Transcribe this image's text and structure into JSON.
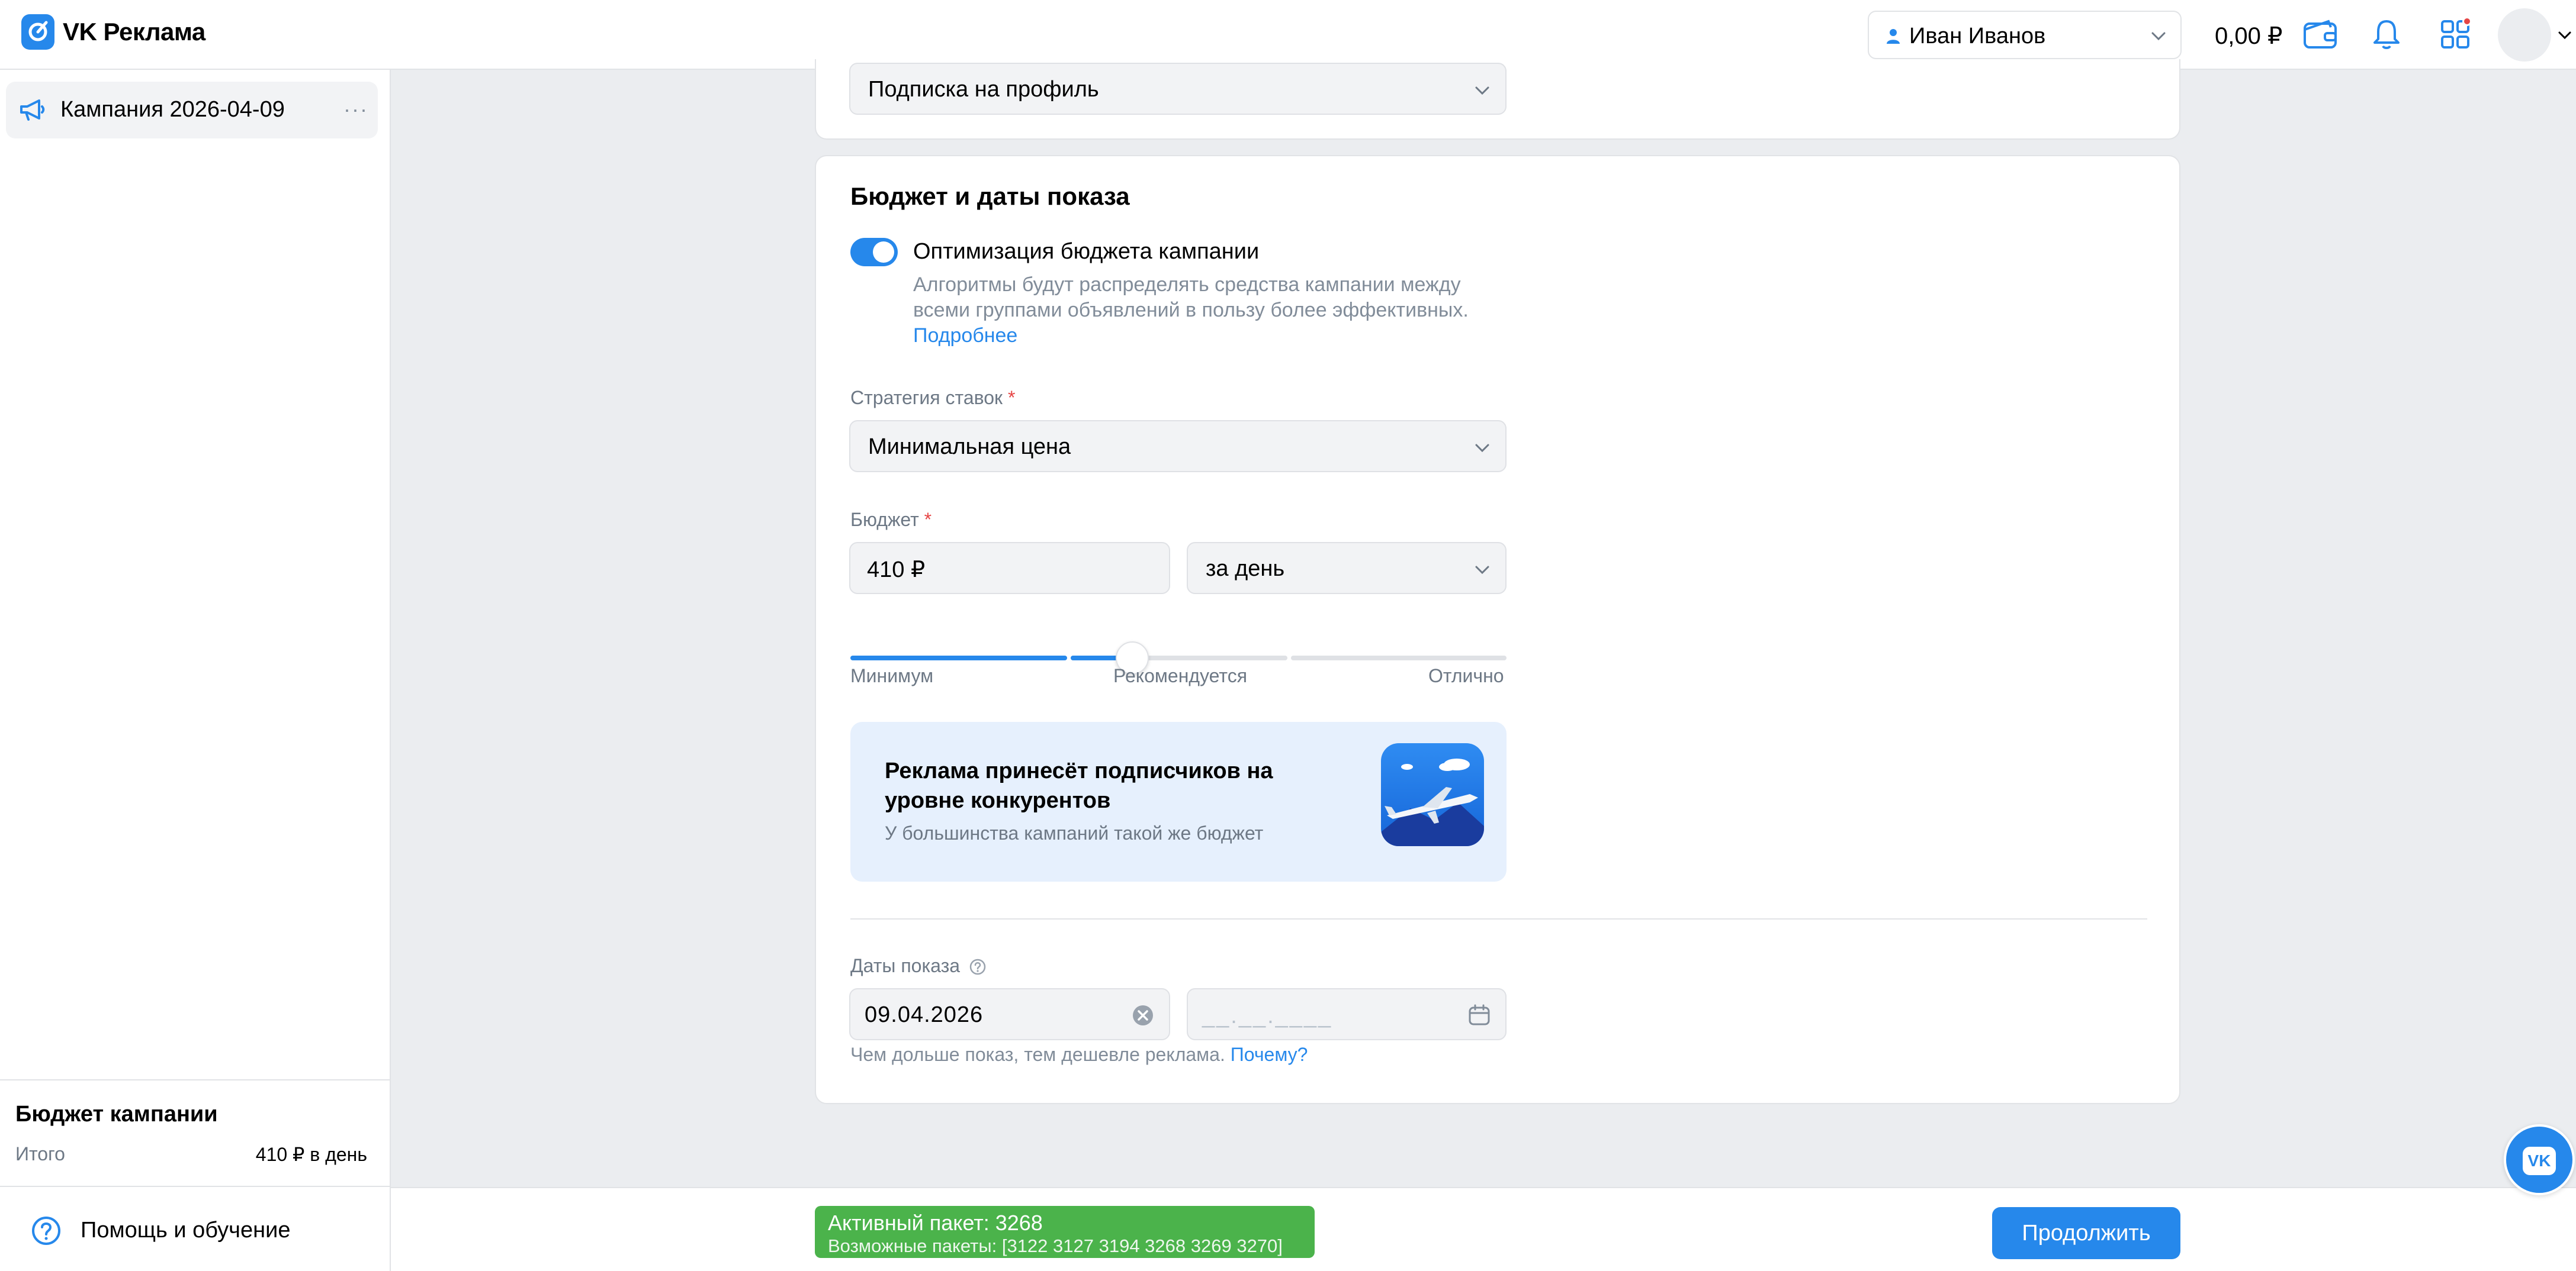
{
  "header": {
    "brand": "VK Реклама",
    "account_name": "Иван Иванов",
    "balance": "0,00 ₽"
  },
  "sidebar": {
    "campaign_label": "Кампания 2026-04-09",
    "more_label": "···",
    "budget_title": "Бюджет кампании",
    "budget_total_label": "Итого",
    "budget_total_value": "410 ₽ в день",
    "help_label": "Помощь и обучение"
  },
  "objective": {
    "select_value": "Подписка на профиль"
  },
  "budget_section": {
    "title": "Бюджет и даты показа",
    "toggle_on": true,
    "toggle_label": "Оптимизация бюджета кампании",
    "toggle_desc": "Алгоритмы будут распределять средства кампании между всеми группами объявлений в пользу более эффективных.",
    "toggle_link": "Подробнее",
    "strategy_label": "Стратегия ставок",
    "strategy_value": "Минимальная цена",
    "budget_label": "Бюджет",
    "required_mark": "*",
    "budget_value": "410 ₽",
    "period_value": "за день",
    "slider": {
      "value_fraction": 0.43,
      "label_min": "Минимум",
      "label_mid": "Рекомендуется",
      "label_max": "Отлично"
    },
    "banner_title": "Реклама принесёт подписчиков на уровне конкурентов",
    "banner_sub": "У большинства кампаний такой же бюджет",
    "dates_label": "Даты показа",
    "start_date": "09.04.2026",
    "end_date_placeholder": "__.__.____",
    "dates_hint": "Чем дольше показ, тем дешевле реклама.",
    "dates_hint_link": "Почему?"
  },
  "footer": {
    "active_package": "Активный пакет: 3268",
    "possible_packages": "Возможные пакеты: [3122 3127 3194 3268 3269 3270]",
    "continue_label": "Продолжить"
  },
  "fab_label": "VK",
  "colors": {
    "accent": "#2688eb",
    "package_green": "#4bb34b",
    "required_red": "#e64646"
  }
}
